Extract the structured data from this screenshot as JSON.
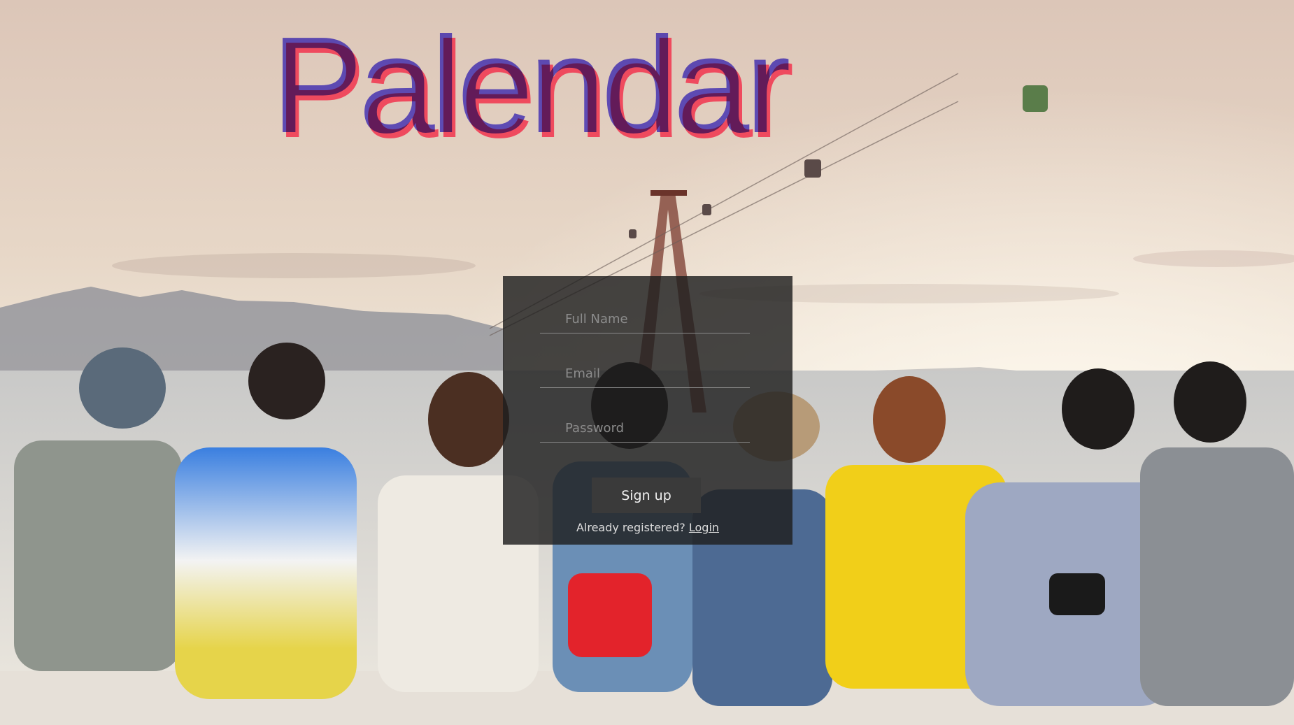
{
  "app": {
    "logo_text": "Palendar"
  },
  "signup": {
    "full_name_placeholder": "Full Name",
    "email_placeholder": "Email",
    "password_placeholder": "Password",
    "submit_label": "Sign up",
    "already_text": "Already registered? ",
    "login_link": "Login"
  },
  "colors": {
    "logo_front": "#6a5cf0",
    "logo_shadow": "#ef4a5e",
    "panel_bg": "#1e1e1e"
  }
}
